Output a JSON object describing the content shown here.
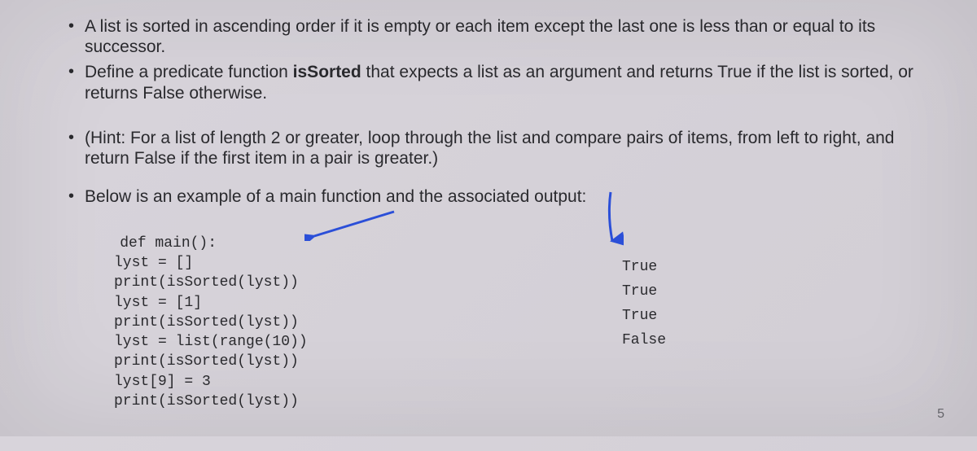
{
  "bullets": {
    "b1": "A list is sorted in ascending order if it is empty or each item except the last one is less than or equal to its successor.",
    "b2_pre": "Define a predicate function ",
    "b2_fn": "isSorted",
    "b2_post": " that expects a list as an argument and returns True if the list is sorted, or returns False otherwise.",
    "b3": "(Hint: For a list of length 2 or greater, loop through the list and compare pairs of items, from left to right, and return False if the first item in a pair is greater.)",
    "b4": "Below is an example of a main function and the associated output:"
  },
  "code": {
    "l0": "def main():",
    "l1": "lyst = []",
    "l2": "print(isSorted(lyst))",
    "l3": "lyst = [1]",
    "l4": "print(isSorted(lyst))",
    "l5": "lyst = list(range(10))",
    "l6": "print(isSorted(lyst))",
    "l7": "lyst[9] = 3",
    "l8": "print(isSorted(lyst))"
  },
  "output": {
    "o1": "True",
    "o2": "True",
    "o3": "True",
    "o4": "False"
  },
  "page_number": "5",
  "colors": {
    "arrow": "#2b4fd8"
  }
}
